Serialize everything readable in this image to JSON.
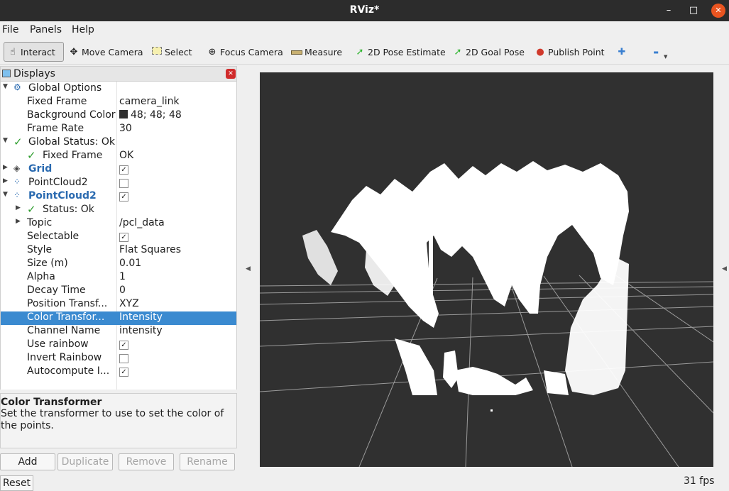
{
  "window": {
    "title": "RViz*",
    "minimize_glyph": "–",
    "maximize_glyph": "□",
    "close_glyph": "✕"
  },
  "menu": [
    "File",
    "Panels",
    "Help"
  ],
  "toolbar": {
    "interact": "Interact",
    "move_camera": "Move Camera",
    "select": "Select",
    "focus_camera": "Focus Camera",
    "measure": "Measure",
    "pose_estimate": "2D Pose Estimate",
    "goal_pose": "2D Goal Pose",
    "publish_point": "Publish Point",
    "add_tool_glyph": "✚",
    "remove_tool_glyph": "▬"
  },
  "panel": {
    "title": "Displays",
    "close_glyph": "✕"
  },
  "tree": {
    "global_options": "Global Options",
    "fixed_frame": {
      "name": "Fixed Frame",
      "value": "camera_link"
    },
    "background_color": {
      "name": "Background Color",
      "value": "48; 48; 48",
      "color": "#303030"
    },
    "frame_rate": {
      "name": "Frame Rate",
      "value": "30"
    },
    "global_status": "Global Status: Ok",
    "status_fixed_frame": {
      "name": "Fixed Frame",
      "value": "OK"
    },
    "grid": {
      "name": "Grid",
      "checked": true
    },
    "pointcloud_a": {
      "name": "PointCloud2",
      "checked": false
    },
    "pointcloud_b": {
      "name": "PointCloud2",
      "checked": true
    },
    "status": "Status: Ok",
    "topic": {
      "name": "Topic",
      "value": "/pcl_data"
    },
    "selectable": {
      "name": "Selectable",
      "checked": true
    },
    "style": {
      "name": "Style",
      "value": "Flat Squares"
    },
    "size": {
      "name": "Size (m)",
      "value": "0.01"
    },
    "alpha": {
      "name": "Alpha",
      "value": "1"
    },
    "decay_time": {
      "name": "Decay Time",
      "value": "0"
    },
    "position_transformer": {
      "name": "Position Transf...",
      "value": "XYZ"
    },
    "color_transformer": {
      "name": "Color Transfor...",
      "value": "Intensity"
    },
    "channel_name": {
      "name": "Channel Name",
      "value": "intensity"
    },
    "use_rainbow": {
      "name": "Use rainbow",
      "checked": true
    },
    "invert_rainbow": {
      "name": "Invert Rainbow",
      "checked": false
    },
    "autocompute": {
      "name": "Autocompute I...",
      "checked": true
    }
  },
  "description": {
    "title": "Color Transformer",
    "text": "Set the transformer to use to set the color of the points."
  },
  "buttons": {
    "add": "Add",
    "duplicate": "Duplicate",
    "remove": "Remove",
    "rename": "Rename"
  },
  "status_bar": {
    "reset": "Reset",
    "fps": "31 fps"
  },
  "colors": {
    "selection": "#3a8ad0",
    "viewport_bg": "#303030",
    "grid_line": "#9a9a9a",
    "points": "#ffffff"
  }
}
